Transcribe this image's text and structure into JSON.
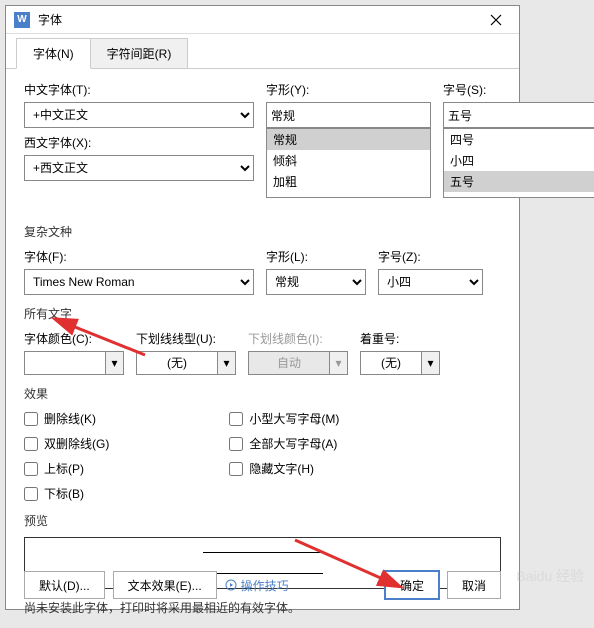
{
  "title": "字体",
  "tabs": {
    "font": "字体(N)",
    "spacing": "字符间距(R)"
  },
  "cn_font_label": "中文字体(T):",
  "cn_font_value": "+中文正文",
  "style_label": "字形(Y):",
  "style_value": "常规",
  "style_options": [
    "常规",
    "倾斜",
    "加粗"
  ],
  "size_label": "字号(S):",
  "size_value": "五号",
  "size_options": [
    "四号",
    "小四",
    "五号"
  ],
  "en_font_label": "西文字体(X):",
  "en_font_value": "+西文正文",
  "complex_label": "复杂文种",
  "complex_font_label": "字体(F):",
  "complex_font_value": "Times New Roman",
  "complex_style_label": "字形(L):",
  "complex_style_value": "常规",
  "complex_size_label": "字号(Z):",
  "complex_size_value": "小四",
  "all_text_label": "所有文字",
  "font_color_label": "字体颜色(C):",
  "underline_label": "下划线线型(U):",
  "underline_value": "(无)",
  "underline_color_label": "下划线颜色(I):",
  "underline_color_value": "自动",
  "emphasis_label": "着重号:",
  "emphasis_value": "(无)",
  "effects_label": "效果",
  "effects": {
    "strike": "删除线(K)",
    "dstrike": "双删除线(G)",
    "sup": "上标(P)",
    "sub": "下标(B)",
    "smallcaps": "小型大写字母(M)",
    "allcaps": "全部大写字母(A)",
    "hidden": "隐藏文字(H)"
  },
  "preview_label": "预览",
  "hint": "尚未安装此字体，打印时将采用最相近的有效字体。",
  "buttons": {
    "default": "默认(D)...",
    "text_effects": "文本效果(E)...",
    "tips": "操作技巧",
    "ok": "确定",
    "cancel": "取消"
  },
  "watermark": "Baidu 经验"
}
